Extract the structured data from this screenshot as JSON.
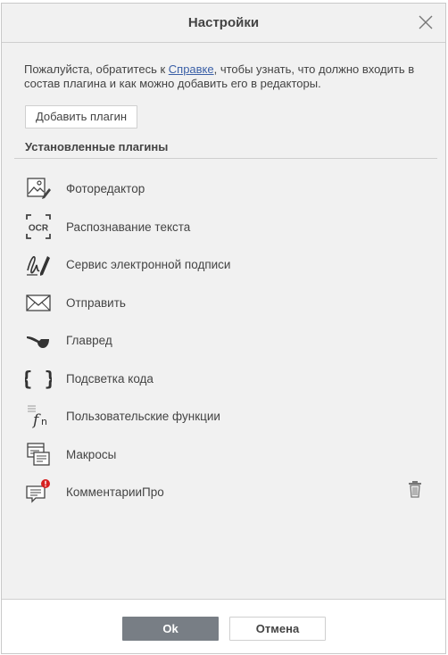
{
  "dialog": {
    "title": "Настройки",
    "info_prefix": "Пожалуйста, обратитесь к ",
    "info_link": "Справке",
    "info_suffix": ", чтобы узнать, что должно входить в состав плагина и как можно добавить его в редакторы.",
    "add_plugin_label": "Добавить плагин",
    "installed_title": "Установленные плагины"
  },
  "plugins": [
    {
      "label": "Фоторедактор",
      "icon": "photo-editor-icon"
    },
    {
      "label": "Распознавание текста",
      "icon": "ocr-icon"
    },
    {
      "label": "Сервис электронной подписи",
      "icon": "signature-pen-icon"
    },
    {
      "label": "Отправить",
      "icon": "envelope-icon"
    },
    {
      "label": "Главред",
      "icon": "pipe-icon"
    },
    {
      "label": "Подсветка кода",
      "icon": "curly-braces-icon"
    },
    {
      "label": "Пользовательские функции",
      "icon": "function-icon"
    },
    {
      "label": "Макросы",
      "icon": "macros-icon"
    },
    {
      "label": "КомментарииПро",
      "icon": "comment-alert-icon",
      "deletable": true
    }
  ],
  "ocr_text": "OCR",
  "footer": {
    "ok_label": "Ok",
    "cancel_label": "Отмена"
  },
  "colors": {
    "link": "#3a5fa6",
    "ok_button": "#787e85",
    "alert_badge": "#d62020"
  }
}
